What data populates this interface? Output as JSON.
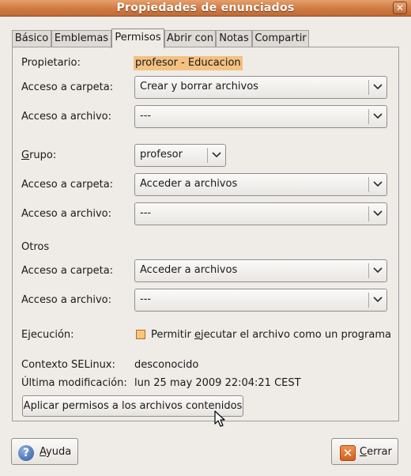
{
  "window": {
    "title": "Propiedades de enunciados",
    "close_glyph": "✕"
  },
  "tabs": [
    {
      "label": "Básico",
      "active": false
    },
    {
      "label": "Emblemas",
      "active": false
    },
    {
      "label": "Permisos",
      "active": true
    },
    {
      "label": "Abrir con",
      "active": false
    },
    {
      "label": "Notas",
      "active": false
    },
    {
      "label": "Compartir",
      "active": false
    }
  ],
  "owner": {
    "label": "Propietario:",
    "value": "profesor - Educacion",
    "folder_access_label": "Acceso a carpeta:",
    "folder_access_value": "Crear y borrar archivos",
    "file_access_label": "Acceso a archivo:",
    "file_access_value": "---"
  },
  "group": {
    "label_pre": "",
    "label_ul": "G",
    "label_post": "rupo:",
    "value": "profesor",
    "folder_access_label": "Acceso a carpeta:",
    "folder_access_value": "Acceder a archivos",
    "file_access_label": "Acceso a archivo:",
    "file_access_value": "---"
  },
  "others": {
    "label": "Otros",
    "folder_access_label": "Acceso a carpeta:",
    "folder_access_value": "Acceder a archivos",
    "file_access_label": "Acceso a archivo:",
    "file_access_value": "---"
  },
  "execution": {
    "label": "Ejecución:",
    "checkbox_pre": "Permitir ",
    "checkbox_ul": "e",
    "checkbox_post": "jecutar el archivo como un programa",
    "checked": false
  },
  "selinux": {
    "label": "Contexto SELinux:",
    "value": "desconocido"
  },
  "modified": {
    "label": "Última modificación:",
    "value": "lun 25 may 2009 22:04:21 CEST"
  },
  "apply_button": "Aplicar permisos a los archivos contenidos",
  "buttons": {
    "help_pre": "",
    "help_ul": "A",
    "help_post": "yuda",
    "help_icon": "help-icon",
    "close_pre": "",
    "close_ul": "C",
    "close_post": "errar",
    "close_icon": "close-icon"
  },
  "colors": {
    "titlebar": "#cf7a43",
    "highlight": "#f4c181",
    "checkbox": "#f7c57c"
  }
}
